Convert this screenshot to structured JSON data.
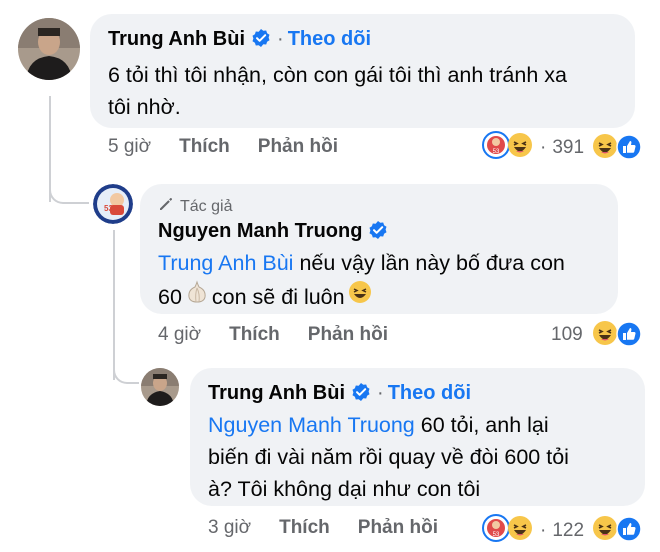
{
  "comments": [
    {
      "author": "Trung Anh Bùi",
      "follow_label": "Theo dõi",
      "separator": "·",
      "text_line1": "6 tỏi thì tôi nhận, còn con gái tôi thì anh tránh xa",
      "text_line2": "tôi nhờ.",
      "time": "5 giờ",
      "like_label": "Thích",
      "reply_label": "Phản hồi",
      "reaction_count": "391",
      "reaction_separator": "·"
    },
    {
      "author_tag": "Tác giả",
      "author": "Nguyen Manh Truong",
      "mention": "Trung Anh Bùi",
      "text_line1_rest": " nếu vậy lần này bố đưa con",
      "text_line2_a": "60",
      "text_line2_b": " con sẽ đi luôn",
      "time": "4 giờ",
      "like_label": "Thích",
      "reply_label": "Phản hồi",
      "reaction_count": "109"
    },
    {
      "author": "Trung Anh Bùi",
      "follow_label": "Theo dõi",
      "separator": "·",
      "mention": "Nguyen Manh Truong",
      "text_line1_rest": " 60 tỏi, anh lại",
      "text_line2": "biến đi vài năm rồi quay về đòi 600 tỏi",
      "text_line3": "à? Tôi không dại như con tôi",
      "time": "3 giờ",
      "like_label": "Thích",
      "reply_label": "Phản hồi",
      "reaction_count": "122",
      "reaction_separator": "·"
    }
  ],
  "icons": [
    "verified-badge-icon",
    "haha-emoji-icon",
    "like-icon",
    "sticker-icon",
    "pencil-icon",
    "garlic-emoji-icon",
    "laughing-emoji-icon"
  ],
  "colors": {
    "link": "#1877f2",
    "bubble": "#f0f2f5",
    "secondary": "#65676b"
  }
}
